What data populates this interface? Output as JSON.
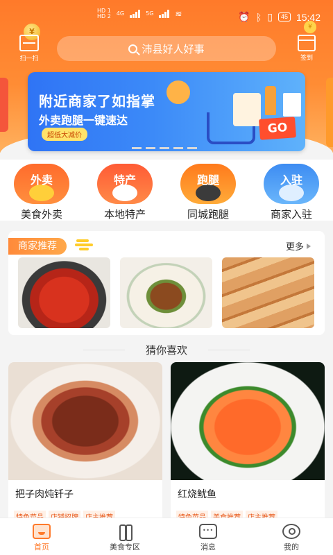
{
  "status_bar": {
    "hd1": "HD 1",
    "hd2": "HD 2",
    "net1": "4G",
    "net2": "5G",
    "battery": "45",
    "time": "15:42"
  },
  "header": {
    "scan_label": "扫一扫",
    "coin_glyph": "¥",
    "search_placeholder": "沛县好人好事",
    "checkin_label": "签到"
  },
  "banner": {
    "title": "附近商家了如指掌",
    "subtitle": "外卖跑腿一键速达",
    "badge": "超低大减价",
    "go_text": "GO"
  },
  "categories": [
    {
      "icon_text": "外卖",
      "label": "美食外卖",
      "icon": "delivery-icon"
    },
    {
      "icon_text": "特产",
      "label": "本地特产",
      "icon": "specialty-icon"
    },
    {
      "icon_text": "跑腿",
      "label": "同城跑腿",
      "icon": "errand-icon"
    },
    {
      "icon_text": "入驻",
      "label": "商家入驻",
      "icon": "merchant-join-icon"
    }
  ],
  "merchant_section": {
    "title": "商家推荐",
    "more": "更多"
  },
  "guess_title": "猜你喜欢",
  "products": [
    {
      "name": "把子肉炖钎子",
      "tags": [
        "特色菜品",
        "店铺招牌",
        "店主推荐"
      ]
    },
    {
      "name": "红烧鱿鱼",
      "tags": [
        "特色菜品",
        "美食推荐",
        "店主推荐"
      ]
    }
  ],
  "bottom_nav": [
    {
      "label": "首页",
      "icon": "home-icon",
      "active": true
    },
    {
      "label": "美食专区",
      "icon": "food-zone-icon",
      "active": false
    },
    {
      "label": "消息",
      "icon": "message-icon",
      "active": false
    },
    {
      "label": "我的",
      "icon": "profile-icon",
      "active": false
    }
  ],
  "colors": {
    "brand_orange": "#ff7a2a",
    "banner_blue": "#2f74f5",
    "tag_text": "#e85a1c"
  }
}
